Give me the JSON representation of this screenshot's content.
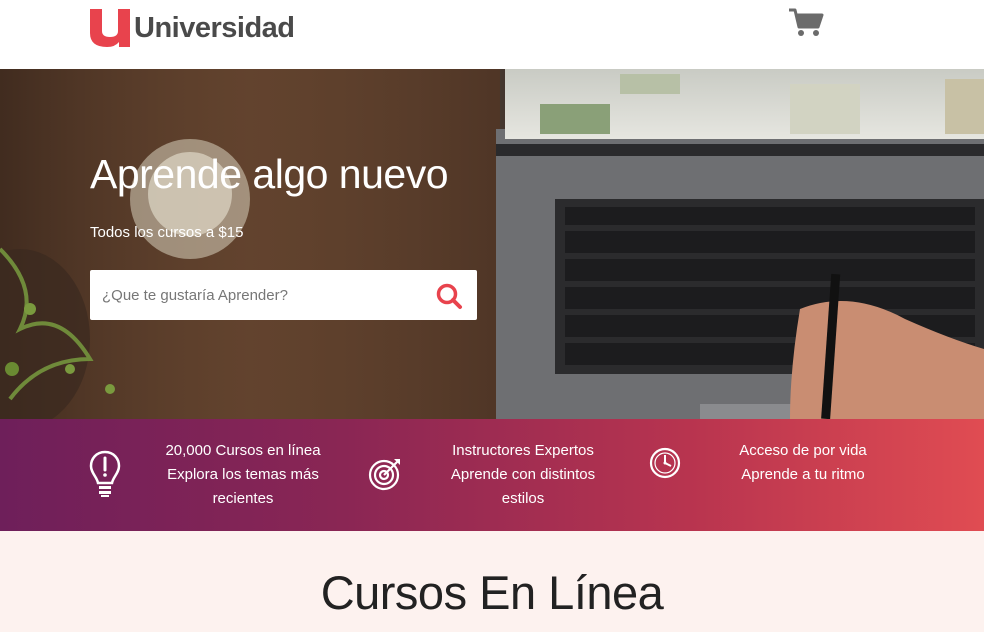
{
  "header": {
    "logo_letter": "u",
    "logo_text": "Universidad",
    "cart_icon": "shopping-cart-icon"
  },
  "hero": {
    "title": "Aprende algo nuevo",
    "subtitle": "Todos los cursos a $15",
    "search": {
      "placeholder": "¿Que te gustaría Aprender?",
      "value": "",
      "icon": "search-icon"
    }
  },
  "features": [
    {
      "icon": "lightbulb-icon",
      "line1": "20,000 Cursos en línea",
      "line2": "Explora los temas más",
      "line3": "recientes"
    },
    {
      "icon": "target-icon",
      "line1": "Instructores Expertos",
      "line2": "Aprende con distintos",
      "line3": "estilos"
    },
    {
      "icon": "clock-icon",
      "line1": "Acceso de por vida",
      "line2": "Aprende a tu ritmo"
    }
  ],
  "courses": {
    "title": "Cursos En Línea"
  },
  "colors": {
    "brand_red": "#e8434d",
    "logo_gray": "#4a4a4a",
    "band_start": "#6e1f5a",
    "band_end": "#e04c52",
    "section_bg": "#fdf2ef"
  }
}
